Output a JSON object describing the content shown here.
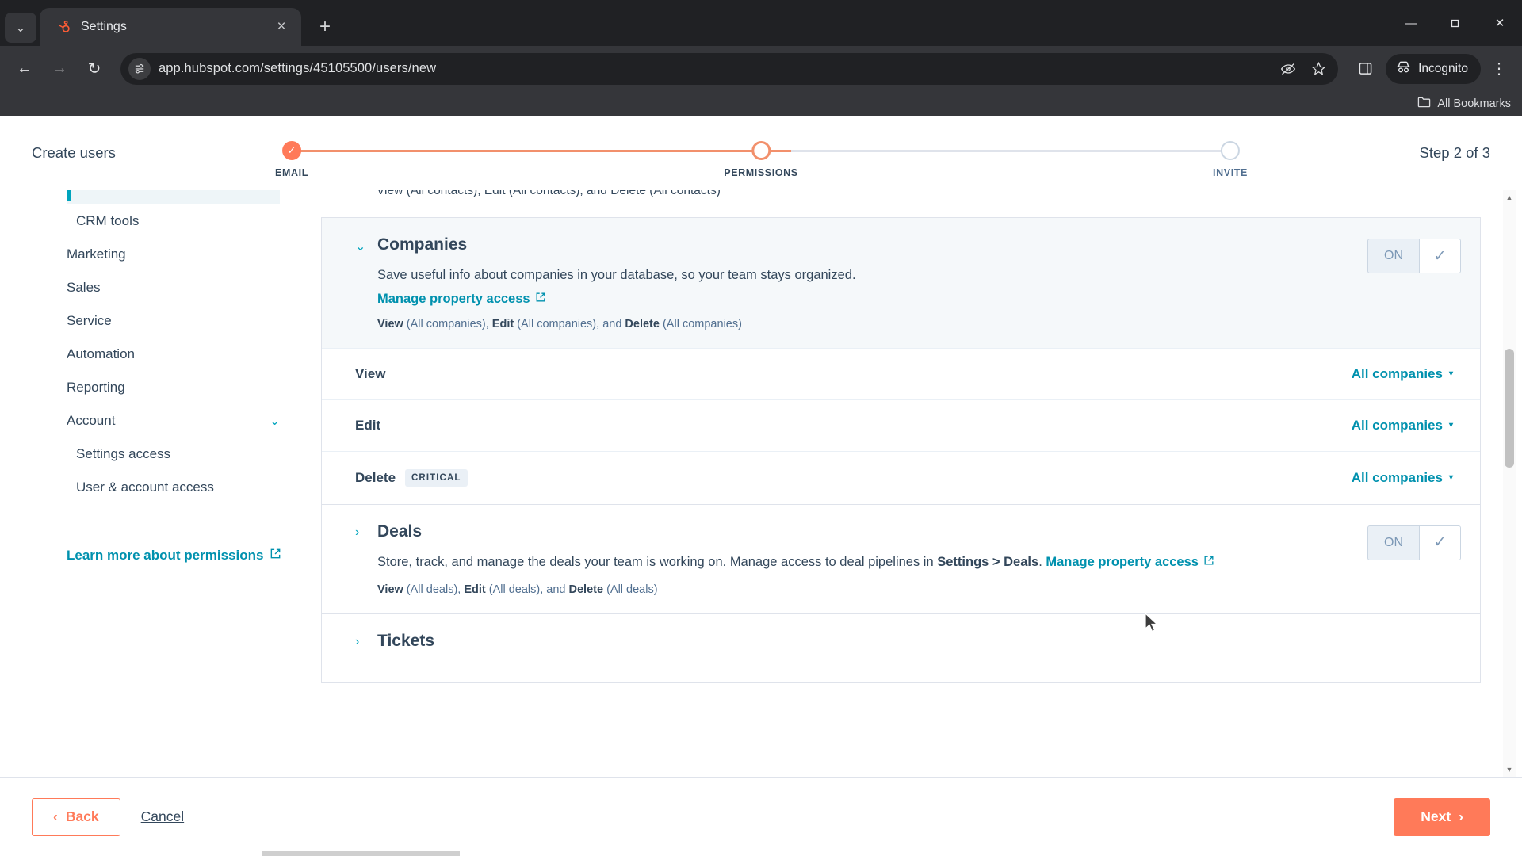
{
  "browser": {
    "tab": {
      "title": "Settings",
      "favicon": "hubspot-sprocket-icon",
      "close_label": "×"
    },
    "tab_list_label": "⌄",
    "new_tab_label": "+",
    "window_controls": {
      "minimize": "—",
      "maximize": "❐",
      "close": "✕"
    },
    "nav": {
      "back": "←",
      "forward": "→",
      "reload": "↻"
    },
    "url": "app.hubspot.com/settings/45105500/users/new",
    "omnibox_icon": "site-info-icon",
    "omni_actions": [
      "tracking-protection-off-icon",
      "bookmark-star-icon"
    ],
    "side_panel_icon": "side-panel-icon",
    "profile": {
      "label": "Incognito",
      "icon": "incognito-hat-icon"
    },
    "menu_icon": "kebab-menu-icon",
    "bookmarks": {
      "all_label": "All Bookmarks",
      "folder_icon": "folder-icon"
    }
  },
  "wizard": {
    "title": "Create users",
    "step_count": "Step 2 of 3",
    "steps": [
      {
        "label": "EMAIL",
        "state": "done"
      },
      {
        "label": "PERMISSIONS",
        "state": "current"
      },
      {
        "label": "INVITE",
        "state": "todo"
      }
    ]
  },
  "sidebar": {
    "items": [
      {
        "label": "CRM tools",
        "level": 1,
        "chevron": ""
      },
      {
        "label": "Marketing",
        "level": 0,
        "chevron": ""
      },
      {
        "label": "Sales",
        "level": 0,
        "chevron": ""
      },
      {
        "label": "Service",
        "level": 0,
        "chevron": ""
      },
      {
        "label": "Automation",
        "level": 0,
        "chevron": ""
      },
      {
        "label": "Reporting",
        "level": 0,
        "chevron": ""
      },
      {
        "label": "Account",
        "level": 0,
        "chevron": "⌄"
      },
      {
        "label": "Settings access",
        "level": 1,
        "chevron": ""
      },
      {
        "label": "User & account access",
        "level": 1,
        "chevron": ""
      }
    ],
    "learn_more": {
      "label": "Learn more about permissions",
      "icon": "external-link-icon"
    }
  },
  "main": {
    "clipped_top_text": "View (All contacts), Edit (All contacts), and Delete (All contacts)",
    "companies": {
      "twisty": "⌄",
      "title": "Companies",
      "description": "Save useful info about companies in your database, so your team stays organized.",
      "property_link": "Manage property access",
      "property_link_icon": "external-link-icon",
      "summary_prefix": "View",
      "summary": " (All companies), ",
      "summary_b2": "Edit",
      "summary2": " (All companies), and ",
      "summary_b3": "Delete",
      "summary3": " (All companies)",
      "toggle": {
        "state_label": "ON",
        "check_icon": "check-icon"
      },
      "rows": [
        {
          "label": "View",
          "badge": "",
          "value": "All companies",
          "caret": "▾"
        },
        {
          "label": "Edit",
          "badge": "",
          "value": "All companies",
          "caret": "▾"
        },
        {
          "label": "Delete",
          "badge": "CRITICAL",
          "value": "All companies",
          "caret": "▾"
        }
      ]
    },
    "deals": {
      "twisty": "›",
      "title": "Deals",
      "description": "Store, track, and manage the deals your team is working on. Manage access to deal pipelines in",
      "description_bold": "Settings > Deals",
      "description_tail": ".",
      "property_link": "Manage property access",
      "property_link_icon": "external-link-icon",
      "summary_prefix": "View",
      "summary": " (All deals), ",
      "summary_b2": "Edit",
      "summary2": " (All deals), and ",
      "summary_b3": "Delete",
      "summary3": " (All deals)",
      "toggle": {
        "state_label": "ON",
        "check_icon": "check-icon"
      }
    },
    "tickets": {
      "twisty": "›",
      "title": "Tickets"
    }
  },
  "footer": {
    "back": "Back",
    "back_icon": "chevron-left-icon",
    "cancel": "Cancel",
    "next": "Next",
    "next_icon": "chevron-right-icon"
  },
  "colors": {
    "accent": "#ff7a59",
    "link": "#0091ae",
    "text": "#33475b",
    "muted": "#516f90",
    "border": "#dfe3eb",
    "panel_bg": "#f5f8fa"
  }
}
